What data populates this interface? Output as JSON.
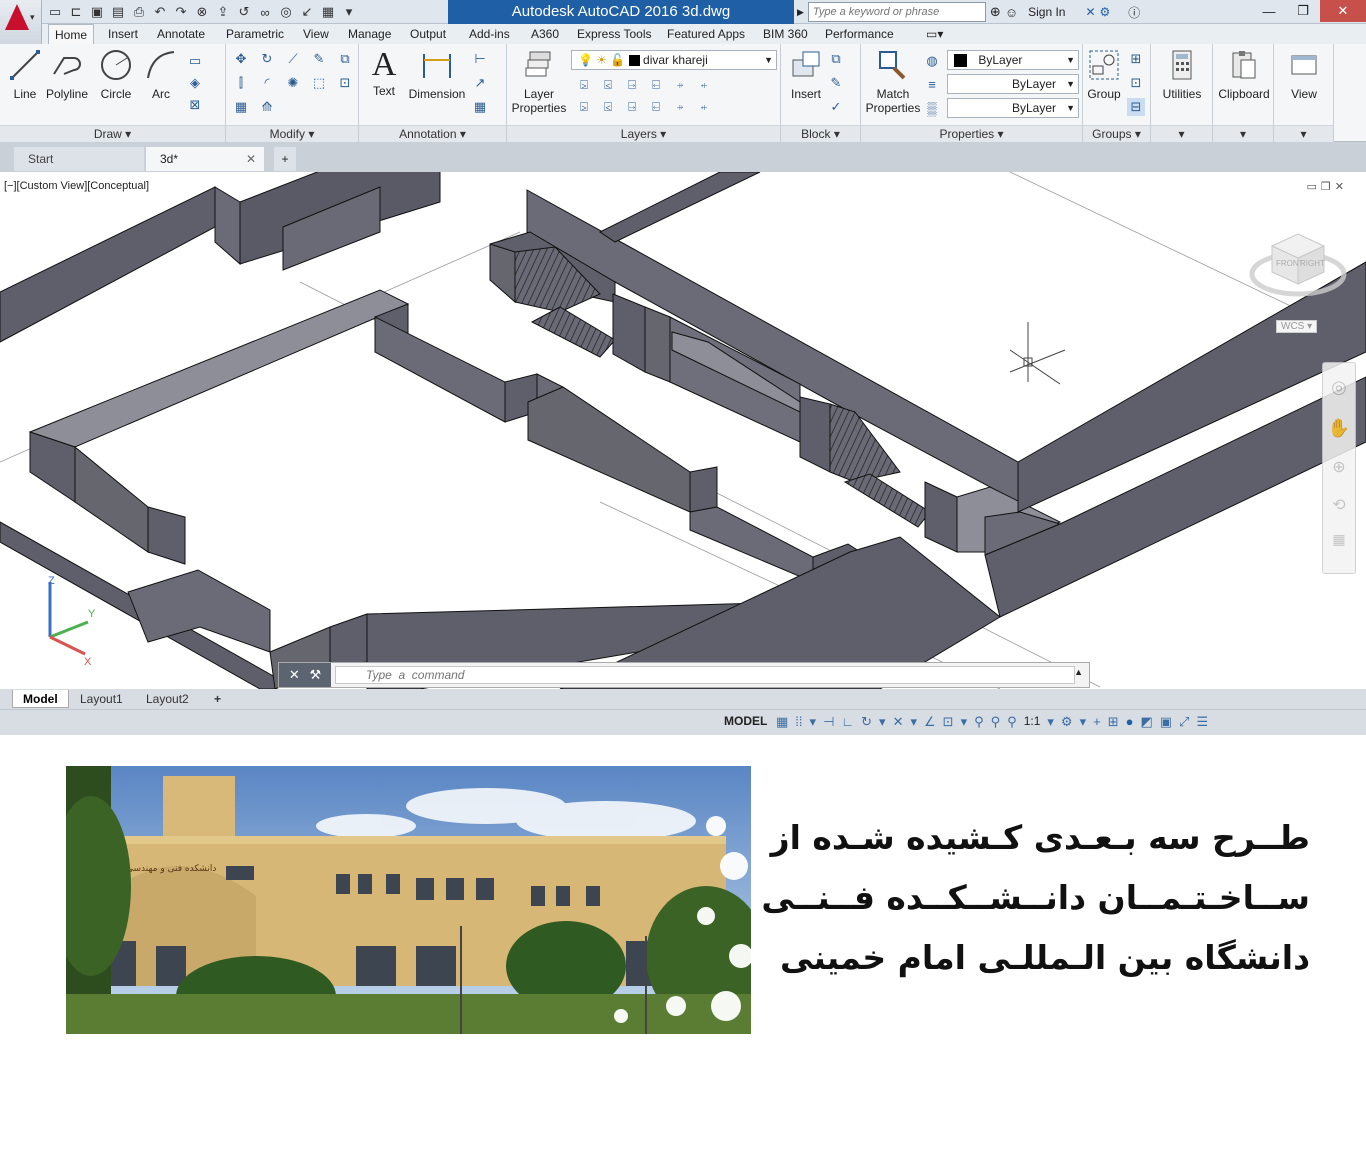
{
  "titlebar": {
    "title": "Autodesk AutoCAD 2016    3d.dwg",
    "search_placeholder": "Type a keyword or phrase",
    "signin": "Sign In"
  },
  "ribbon_tabs": [
    "Home",
    "Insert",
    "Annotate",
    "Parametric",
    "View",
    "Manage",
    "Output",
    "Add-ins",
    "A360",
    "Express Tools",
    "Featured Apps",
    "BIM 360",
    "Performance"
  ],
  "draw": {
    "title": "Draw",
    "line": "Line",
    "polyline": "Polyline",
    "circle": "Circle",
    "arc": "Arc"
  },
  "modify": {
    "title": "Modify"
  },
  "annotation": {
    "title": "Annotation",
    "text": "Text",
    "dimension": "Dimension"
  },
  "layers": {
    "title": "Layers",
    "layer_properties_1": "Layer",
    "layer_properties_2": "Properties",
    "current_layer": "divar khareji"
  },
  "block": {
    "title": "Block",
    "insert": "Insert"
  },
  "properties": {
    "title": "Properties",
    "match_1": "Match",
    "match_2": "Properties",
    "color": "ByLayer",
    "linetype": "ByLayer",
    "lineweight": "ByLayer"
  },
  "groups": {
    "title": "Groups",
    "group": "Group"
  },
  "utilities": "Utilities",
  "clipboard": "Clipboard",
  "view": "View",
  "doc_tabs": {
    "start": "Start",
    "active": "3d*"
  },
  "viewport": {
    "label": "[−][Custom View][Conceptual]",
    "wcs": "WCS",
    "cube_top": "FRONT",
    "cube_right": "RIGHT"
  },
  "command": {
    "placeholder": "Type  a  command"
  },
  "layout_tabs": [
    "Model",
    "Layout1",
    "Layout2"
  ],
  "status": {
    "model": "MODEL",
    "scale": "1:1"
  },
  "caption": {
    "line1": "طــرح سه بـعـدی کـشیده شـده از",
    "line2": "ســاخـتـمــان  دانــشــکــده  فــنــی",
    "line3": "دانشگاه بین الـمللـی امام خمینی"
  },
  "photo": {
    "sign_text": "دانشکده فنی و مهندسی"
  },
  "colors": {
    "accent": "#1e5fa6",
    "wall": "#5f5f6b",
    "wall_top": "#8e8e99",
    "logo": "#c8102e"
  }
}
